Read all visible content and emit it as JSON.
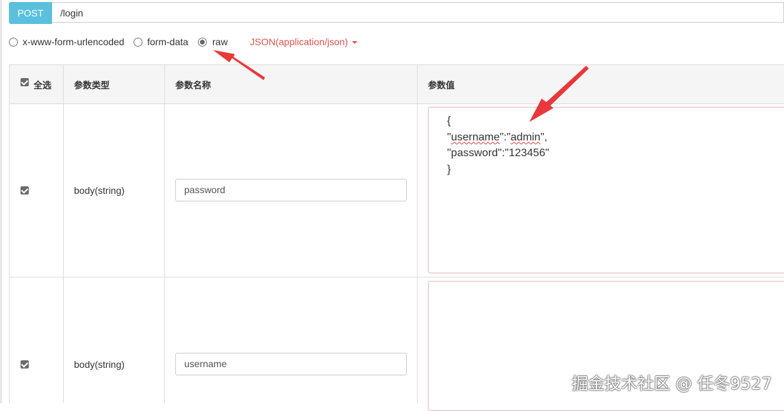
{
  "request": {
    "method": "POST",
    "url": "/login"
  },
  "body_types": [
    {
      "label": "x-www-form-urlencoded",
      "checked": false
    },
    {
      "label": "form-data",
      "checked": false
    },
    {
      "label": "raw",
      "checked": true
    }
  ],
  "content_type": "JSON(application/json)",
  "table": {
    "headers": {
      "select_all": "全选",
      "param_type": "参数类型",
      "param_name": "参数名称",
      "param_value": "参数值"
    },
    "rows": [
      {
        "checked": true,
        "type": "body(string)",
        "name": "password",
        "value_lines": [
          "{",
          "\"username\":\"admin\",",
          "\"password\":\"123456\"",
          "}"
        ]
      },
      {
        "checked": true,
        "type": "body(string)",
        "name": "username",
        "value_lines": []
      }
    ]
  },
  "annotations": {
    "arrow_color": "#e8383b"
  },
  "watermark": "掘金技术社区 @ 任冬9527"
}
